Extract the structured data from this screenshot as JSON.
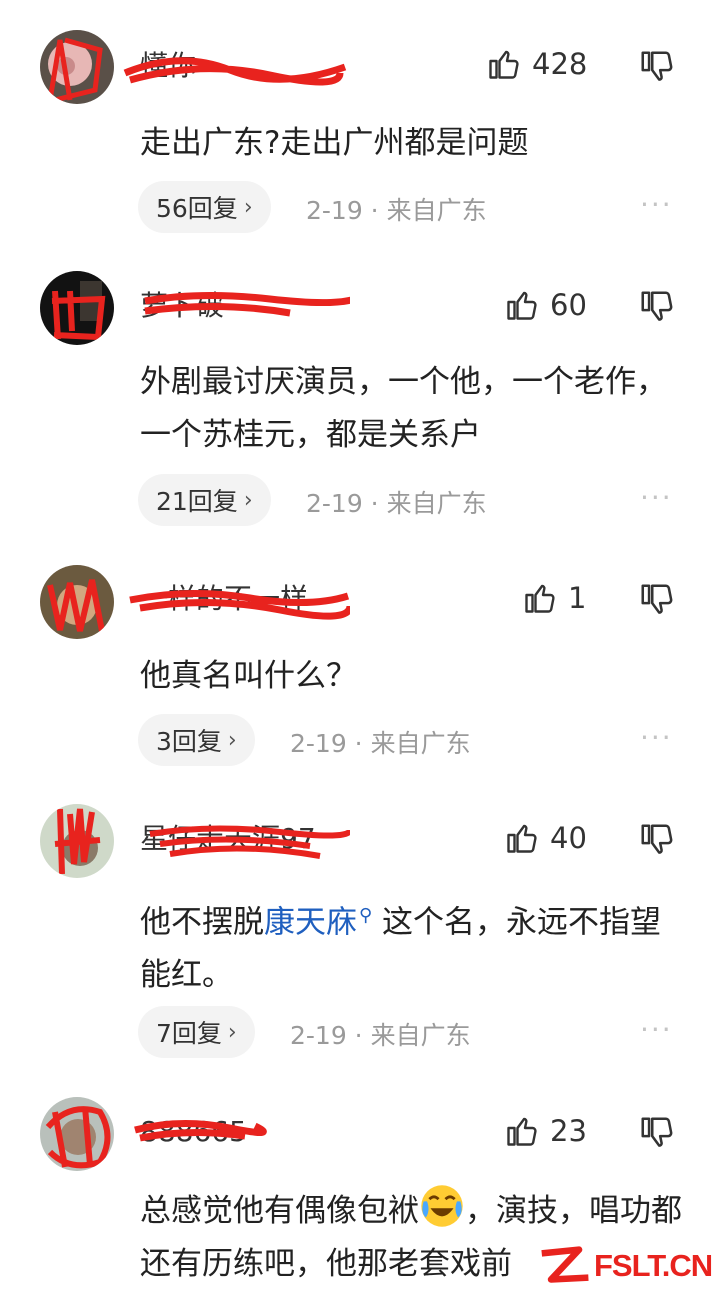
{
  "comments": [
    {
      "username": "懂你",
      "likes": "428",
      "text": "走出广东?走出广州都是问题",
      "replies": "56回复",
      "meta": "2-19 · 来自广东"
    },
    {
      "username": "萝卜破",
      "likes": "60",
      "text": "外剧最讨厌演员，一个他，一个老作，一个苏桂元，都是关系户",
      "replies": "21回复",
      "meta": "2-19 · 来自广东"
    },
    {
      "username": "一样的不一样",
      "likes": "1",
      "text": "他真名叫什么？",
      "replies": "3回复",
      "meta": "2-19 · 来自广东"
    },
    {
      "username": "星仔走天涯97",
      "likes": "40",
      "text_before": "他不摆脱",
      "text_link": "康天庥",
      "text_after": "这个名，永远不指望能红。",
      "replies": "7回复",
      "meta": "2-19 · 来自广东"
    },
    {
      "username": "888665",
      "likes": "23",
      "text_before": "总感觉他有偶像包袱",
      "text_after": "，演技，唱功都还有历练吧，他那老套戏前",
      "replies": "",
      "meta": ""
    }
  ],
  "icons": {
    "like": "thumbs-up-icon",
    "dislike": "thumbs-down-icon",
    "more": "more-dots-icon",
    "chevron": "chevron-right-icon",
    "search": "search-icon",
    "emoji": "crying-laughing-emoji"
  },
  "ui": {
    "chevron": "›",
    "more": "···",
    "search_glyph": "⚲"
  },
  "watermark": {
    "text": "FSLT.CN"
  },
  "colors": {
    "link": "#1f5fbf",
    "meta": "#9a9a9a",
    "scribble": "#e8231e",
    "pill": "#f3f3f3"
  }
}
